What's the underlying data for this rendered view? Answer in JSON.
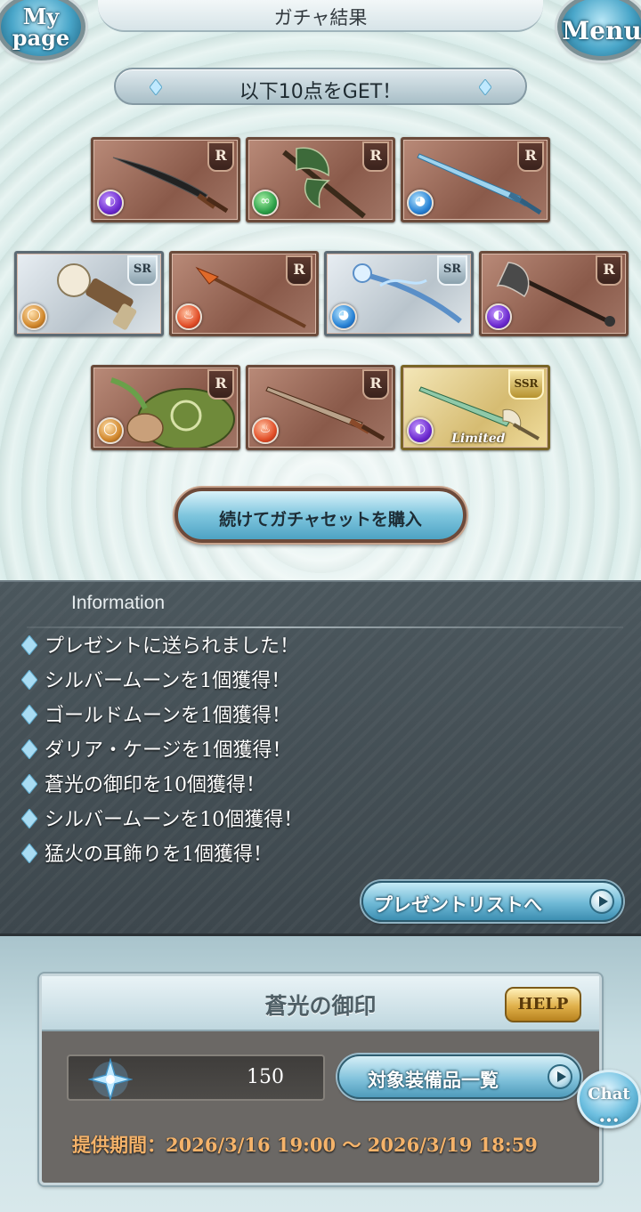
{
  "header": {
    "mypage_label": "My page",
    "title": "ガチャ結果",
    "menu_label": "Menu"
  },
  "get_banner": "以下10点をGET！",
  "items": [
    {
      "rarity": "R",
      "element": "dark",
      "weapon": "sword"
    },
    {
      "rarity": "R",
      "element": "wind",
      "weapon": "axe"
    },
    {
      "rarity": "R",
      "element": "water",
      "weapon": "sword"
    },
    {
      "rarity": "SR",
      "element": "earth",
      "weapon": "hammer"
    },
    {
      "rarity": "R",
      "element": "fire",
      "weapon": "spear"
    },
    {
      "rarity": "SR",
      "element": "water",
      "weapon": "staff"
    },
    {
      "rarity": "R",
      "element": "dark",
      "weapon": "axe"
    },
    {
      "rarity": "R",
      "element": "earth",
      "weapon": "summon"
    },
    {
      "rarity": "R",
      "element": "fire",
      "weapon": "sword"
    },
    {
      "rarity": "SSR",
      "element": "dark",
      "weapon": "sword",
      "badge": "Limited"
    }
  ],
  "buy_button": "続けてガチャセットを購入",
  "information": {
    "heading": "Information",
    "lines": [
      "プレゼントに送られました！",
      "シルバームーンを1個獲得！",
      "ゴールドムーンを1個獲得！",
      "ダリア・ケージを1個獲得！",
      "蒼光の御印を10個獲得！",
      "シルバームーンを10個獲得！",
      "猛火の耳飾りを1個獲得！"
    ],
    "present_button": "プレゼントリストへ"
  },
  "item_box": {
    "title": "蒼光の御印",
    "help_label": "HELP",
    "count": "150",
    "list_button": "対象装備品一覧",
    "period": "提供期間：2026/3/16 19:00 〜 2026/3/19 18:59"
  },
  "chat_label": "Chat",
  "colors": {
    "info_panel": "#4b575d",
    "period_text": "#f5b36a",
    "button_blue": "#6fb9d6"
  }
}
